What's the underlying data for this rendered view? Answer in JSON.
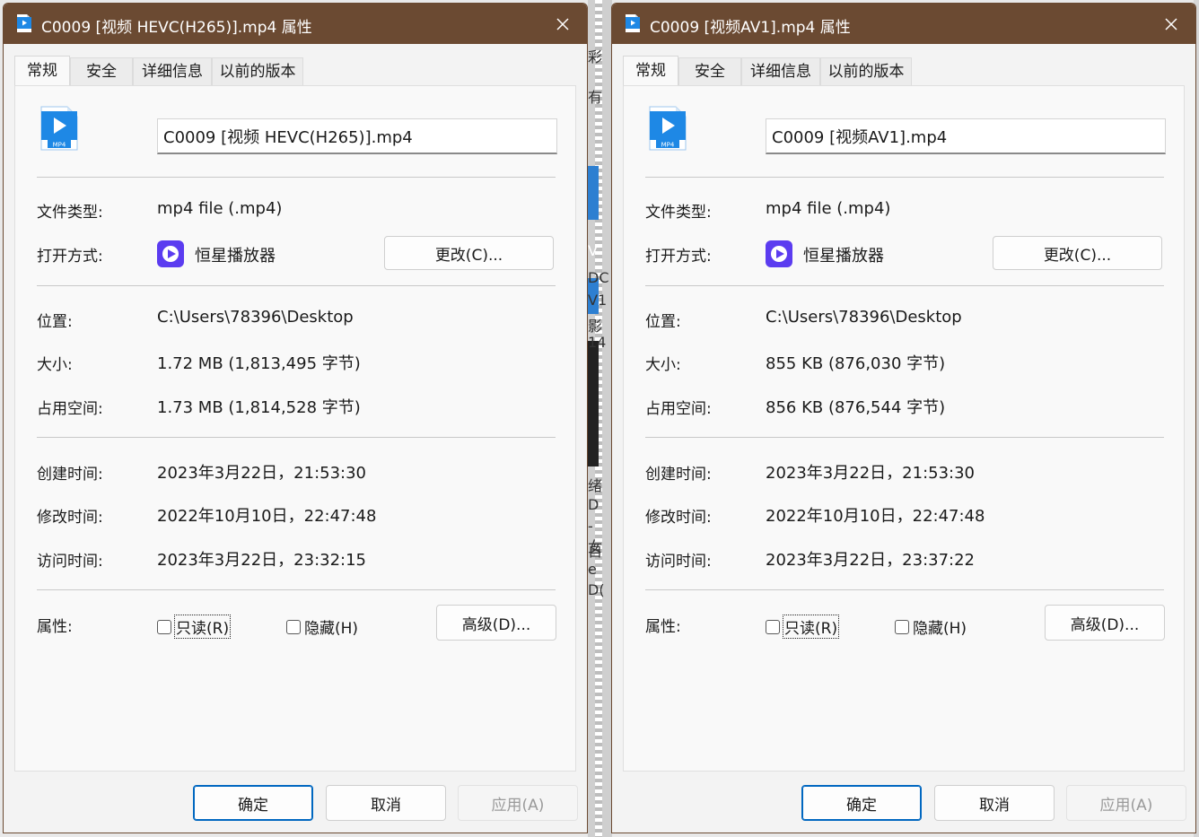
{
  "dialogs": [
    {
      "title": "C0009 [视频 HEVC(H265)].mp4 属性",
      "tabs": [
        "常规",
        "安全",
        "详细信息",
        "以前的版本"
      ],
      "file_icon_label": "MP4",
      "filename": "C0009 [视频 HEVC(H265)].mp4",
      "type_label": "文件类型:",
      "type_value": "mp4 file (.mp4)",
      "open_label": "打开方式:",
      "open_value": "恒星播放器",
      "change_button": "更改(C)...",
      "location_label": "位置:",
      "location_value": "C:\\Users\\78396\\Desktop",
      "size_label": "大小:",
      "size_value": "1.72 MB (1,813,495 字节)",
      "disk_label": "占用空间:",
      "disk_value": "1.73 MB (1,814,528 字节)",
      "created_label": "创建时间:",
      "created_value": "2023年3月22日，21:53:30",
      "modified_label": "修改时间:",
      "modified_value": "2022年10月10日，22:47:48",
      "accessed_label": "访问时间:",
      "accessed_value": "2023年3月22日，23:32:15",
      "attributes_label": "属性:",
      "readonly_label": "只读(R)",
      "hidden_label": "隐藏(H)",
      "advanced_button": "高级(D)...",
      "ok_button": "确定",
      "cancel_button": "取消",
      "apply_button": "应用(A)"
    },
    {
      "title": "C0009 [视频AV1].mp4 属性",
      "tabs": [
        "常规",
        "安全",
        "详细信息",
        "以前的版本"
      ],
      "file_icon_label": "MP4",
      "filename": "C0009 [视频AV1].mp4",
      "type_label": "文件类型:",
      "type_value": "mp4 file (.mp4)",
      "open_label": "打开方式:",
      "open_value": "恒星播放器",
      "change_button": "更改(C)...",
      "location_label": "位置:",
      "location_value": "C:\\Users\\78396\\Desktop",
      "size_label": "大小:",
      "size_value": "855 KB (876,030 字节)",
      "disk_label": "占用空间:",
      "disk_value": "856 KB (876,544 字节)",
      "created_label": "创建时间:",
      "created_value": "2023年3月22日，21:53:30",
      "modified_label": "修改时间:",
      "modified_value": "2022年10月10日，22:47:48",
      "accessed_label": "访问时间:",
      "accessed_value": "2023年3月22日，23:37:22",
      "attributes_label": "属性:",
      "readonly_label": "只读(R)",
      "hidden_label": "隐藏(H)",
      "advanced_button": "高级(D)...",
      "ok_button": "确定",
      "cancel_button": "取消",
      "apply_button": "应用(A)"
    }
  ],
  "background_glyphs": [
    "彩",
    "有",
    "V",
    "DC",
    "V1",
    "影",
    "14",
    "绪",
    "D",
    "-女",
    "自e",
    "-",
    "D("
  ],
  "colors": {
    "titlebar": "#6b4a32",
    "accent": "#0067c0",
    "file_icon": "#1e88e5",
    "player_icon": "#5b3cf0"
  },
  "icons": {
    "title": "mp4-file-icon",
    "close": "close-icon",
    "file": "mp4-file-icon",
    "player": "player-app-icon"
  }
}
